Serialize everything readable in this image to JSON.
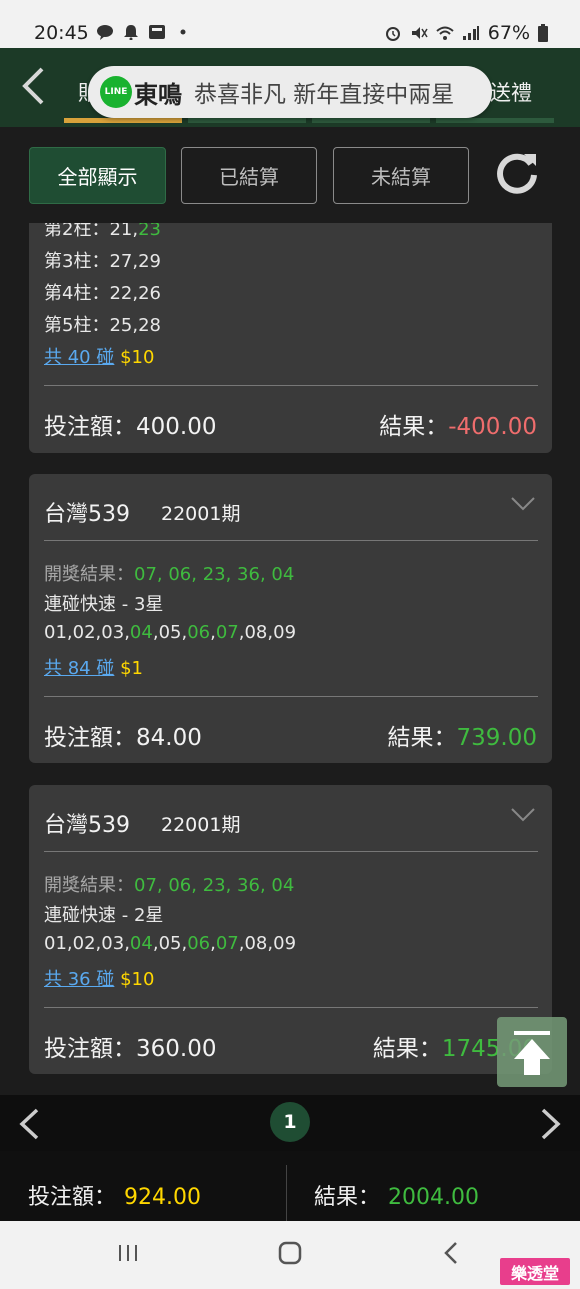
{
  "status_bar": {
    "time": "20:45",
    "battery": "67%"
  },
  "header": {
    "left_partial": "貼",
    "right_partial": "送禮"
  },
  "toast": {
    "app": "LINE",
    "title": "東鳴",
    "message": "恭喜非凡 新年直接中兩星"
  },
  "filters": {
    "all": "全部顯示",
    "settled": "已結算",
    "unsettled": "未結算"
  },
  "cards": [
    {
      "lines": [
        {
          "label": "第2柱：",
          "a": "21,",
          "b": "23"
        },
        {
          "label": "第3柱：",
          "a": "27,29",
          "b": ""
        },
        {
          "label": "第4柱：",
          "a": "22,26",
          "b": ""
        },
        {
          "label": "第5柱：",
          "a": "25,28",
          "b": ""
        }
      ],
      "combos": "共 40 碰",
      "unit": "$10",
      "bet_label": "投注額：",
      "bet": "400.00",
      "result_label": "結果：",
      "result": "-400.00"
    },
    {
      "game": "台灣539",
      "issue": "22001期",
      "draw_label": "開獎結果：",
      "draw": "07, 06, 23, 36, 04",
      "play": "連碰快速 - 3星",
      "numbers": [
        {
          "n": "01",
          "hit": false
        },
        {
          "n": "02",
          "hit": false
        },
        {
          "n": "03",
          "hit": false
        },
        {
          "n": "04",
          "hit": true
        },
        {
          "n": "05",
          "hit": false
        },
        {
          "n": "06",
          "hit": true
        },
        {
          "n": "07",
          "hit": true
        },
        {
          "n": "08",
          "hit": false
        },
        {
          "n": "09",
          "hit": false
        }
      ],
      "combos": "共 84 碰",
      "unit": "$1",
      "bet_label": "投注額：",
      "bet": "84.00",
      "result_label": "結果：",
      "result": "739.00"
    },
    {
      "game": "台灣539",
      "issue": "22001期",
      "draw_label": "開獎結果：",
      "draw": "07, 06, 23, 36, 04",
      "play": "連碰快速 - 2星",
      "numbers": [
        {
          "n": "01",
          "hit": false
        },
        {
          "n": "02",
          "hit": false
        },
        {
          "n": "03",
          "hit": false
        },
        {
          "n": "04",
          "hit": true
        },
        {
          "n": "05",
          "hit": false
        },
        {
          "n": "06",
          "hit": true
        },
        {
          "n": "07",
          "hit": true
        },
        {
          "n": "08",
          "hit": false
        },
        {
          "n": "09",
          "hit": false
        }
      ],
      "combos": "共 36 碰",
      "unit": "$10",
      "bet_label": "投注額：",
      "bet": "360.00",
      "result_label": "結果：",
      "result": "1745.00"
    }
  ],
  "pager": {
    "current": "1"
  },
  "totals": {
    "bet_label": "投注額：",
    "bet": "924.00",
    "result_label": "結果：",
    "result": "2004.00"
  },
  "watermark": "樂透堂",
  "colors": {
    "accent_green": "#3fbb3f",
    "loss_red": "#ef6d6d",
    "unit_yellow": "#ffd700",
    "header_green": "#1c3a27",
    "tab_gold": "#d8a23b"
  }
}
